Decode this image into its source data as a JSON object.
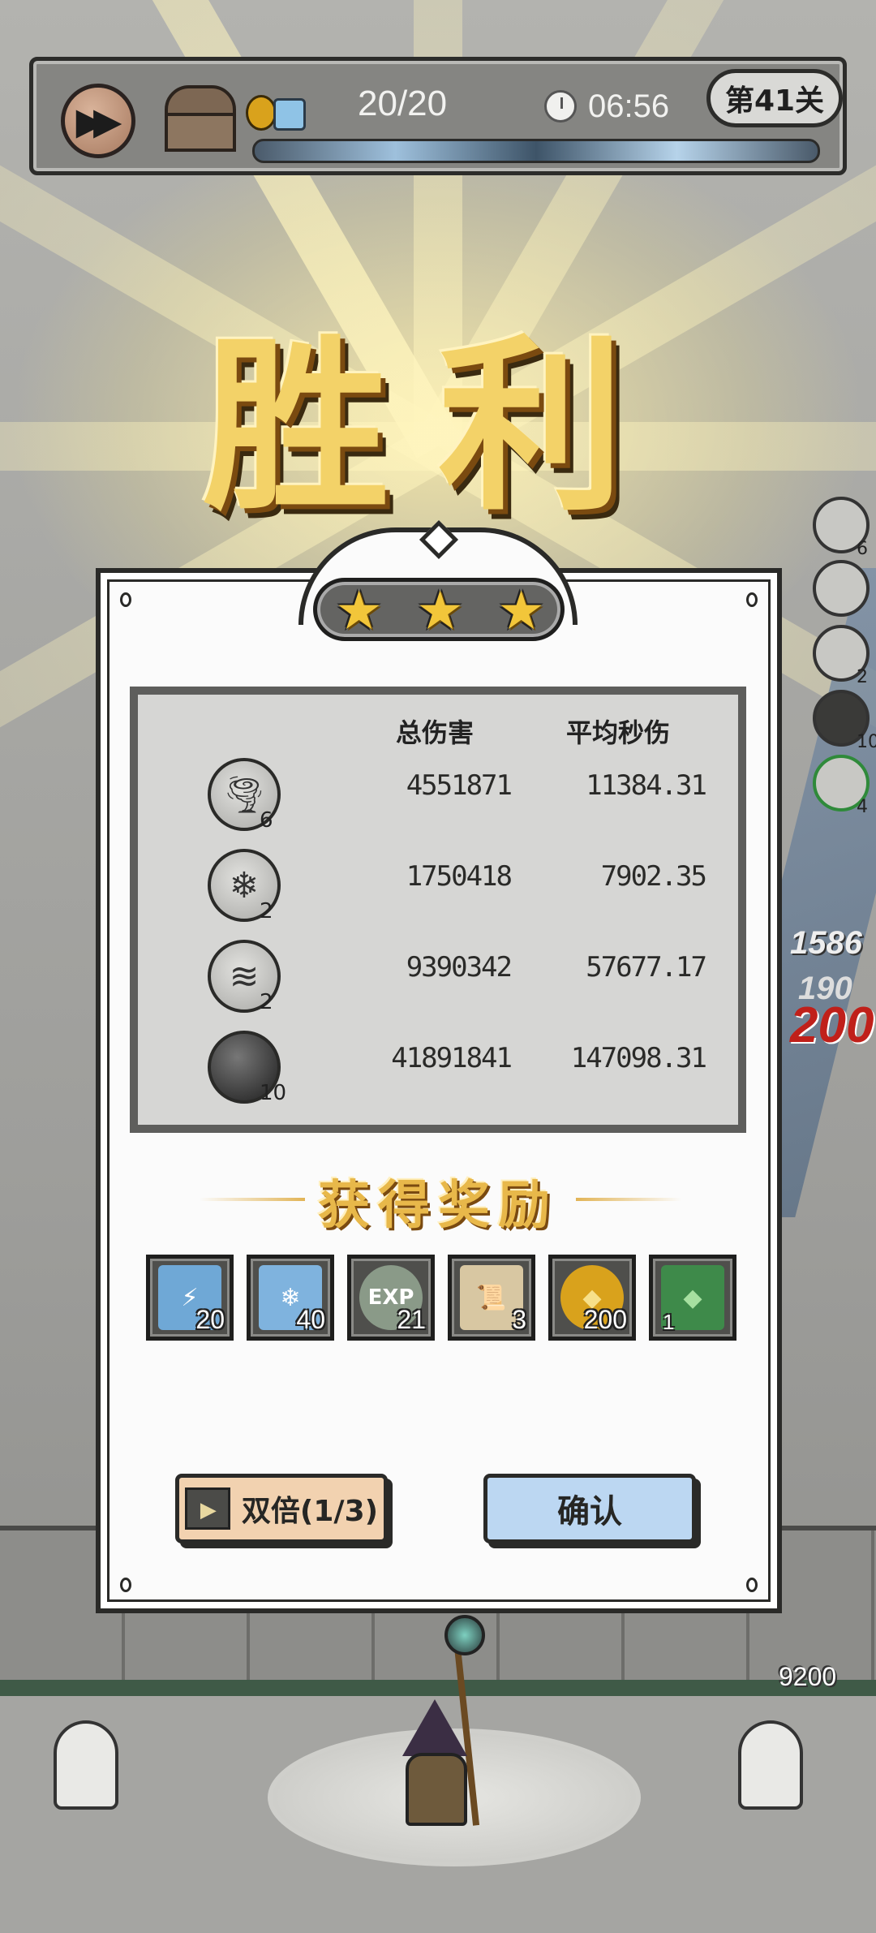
{
  "topbar": {
    "wave": "20/20",
    "timer": "06:56",
    "level": "第41关"
  },
  "victory_title": "胜利",
  "stars": 3,
  "stats": {
    "header_total": "总伤害",
    "header_avg": "平均秒伤",
    "rows": [
      {
        "icon": "tornado-skill-icon",
        "level": "6",
        "total": "4551871",
        "avg": "11384.31"
      },
      {
        "icon": "ice-crystal-skill-icon",
        "level": "2",
        "total": "1750418",
        "avg": "7902.35"
      },
      {
        "icon": "whirlwind-skill-icon",
        "level": "2",
        "total": "9390342",
        "avg": "57677.17"
      },
      {
        "icon": "bomb-skill-icon",
        "level": "10",
        "total": "41891841",
        "avg": "147098.31"
      }
    ]
  },
  "rewards": {
    "title": "获得奖励",
    "items": [
      {
        "icon": "lightning-card-icon",
        "count": "20",
        "color": "#6fa8d6"
      },
      {
        "icon": "ice-card-icon",
        "count": "40",
        "color": "#7fb3de"
      },
      {
        "icon": "exp-orb-icon",
        "label": "EXP",
        "count": "21",
        "color": "#8a9a88"
      },
      {
        "icon": "scroll-icon",
        "count": "3",
        "color": "#d8c7a2"
      },
      {
        "icon": "gold-coin-icon",
        "count": "200",
        "color": "#d9a21c"
      },
      {
        "icon": "green-gem-icon",
        "count": "1",
        "color": "#3e8a4a"
      }
    ]
  },
  "buttons": {
    "double": "双倍(1/3)",
    "confirm": "确认"
  },
  "side": {
    "skill_levels": [
      "6",
      "",
      "2",
      "10",
      "4"
    ],
    "float_damage_1": "1586",
    "float_damage_2": "190",
    "float_damage_3": "200"
  },
  "hp": "9200"
}
